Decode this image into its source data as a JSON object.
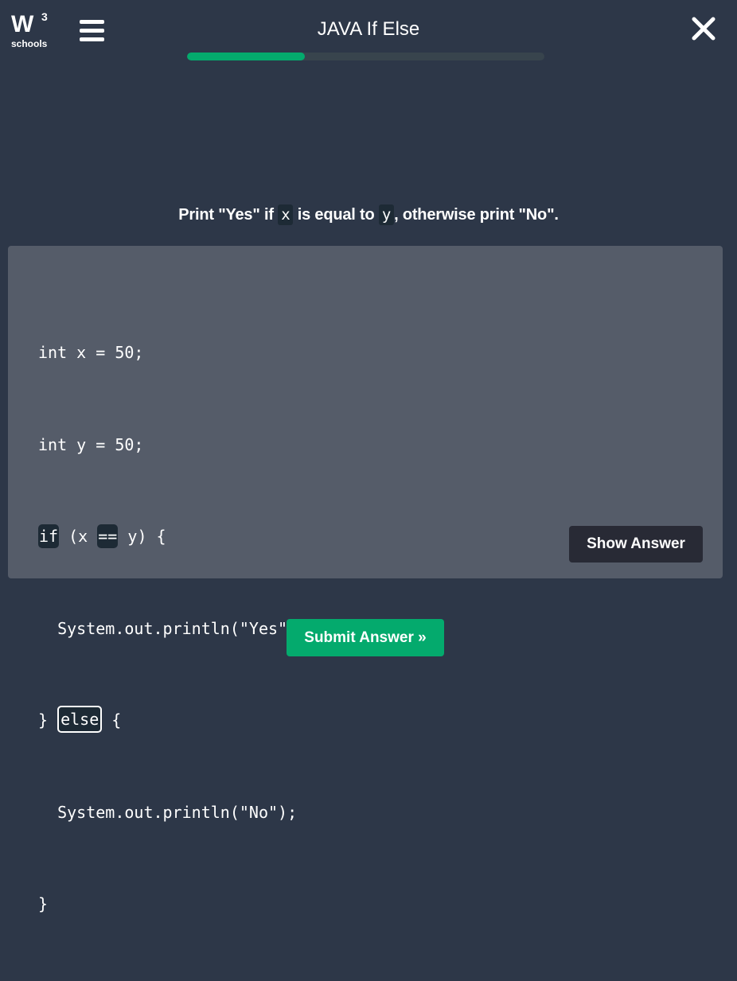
{
  "header": {
    "logo_mark": "W",
    "logo_superscript": "3",
    "logo_word": "schools",
    "title": "JAVA If Else",
    "progress_fraction": 0.33,
    "menu_icon": "hamburger-icon",
    "close_icon": "close-icon"
  },
  "question": {
    "prefix": "Print \"Yes\" if ",
    "var_x": "x",
    "middle": " is equal to ",
    "var_y": "y",
    "suffix": ", otherwise print \"No\"."
  },
  "code": {
    "line1": "int x = 50;",
    "line2": "int y = 50;",
    "line3_kw_if": "if",
    "line3_mid": " (x ",
    "line3_kw_eq": "==",
    "line3_end": " y) {",
    "line4": "  System.out.println(\"Yes\");",
    "line5_start": "} ",
    "line5_blank": "else",
    "line5_end": " {",
    "line6": "  System.out.println(\"No\");",
    "line7": "}"
  },
  "buttons": {
    "show_answer": "Show Answer",
    "submit": "Submit Answer »"
  },
  "colors": {
    "background": "#2d3748",
    "panel": "#555c69",
    "accent_green": "#04aa6d",
    "code_highlight": "#1d2a35",
    "dark_button": "#282a35"
  }
}
